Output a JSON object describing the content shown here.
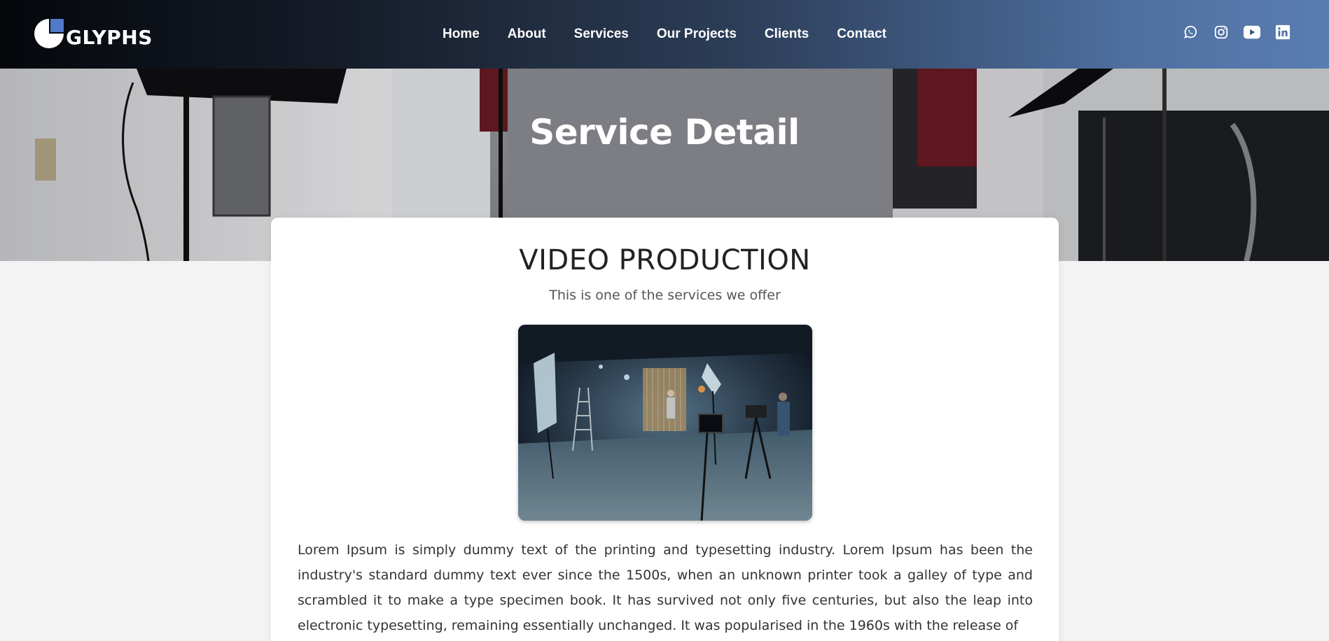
{
  "brand": {
    "logo_text": "GLYPHS",
    "accent": "#4f79c9"
  },
  "nav": {
    "items": [
      {
        "label": "Home"
      },
      {
        "label": "About"
      },
      {
        "label": "Services"
      },
      {
        "label": "Our Projects"
      },
      {
        "label": "Clients"
      },
      {
        "label": "Contact"
      }
    ]
  },
  "socials": [
    "whatsapp-icon",
    "instagram-icon",
    "youtube-icon",
    "linkedin-icon"
  ],
  "hero": {
    "title": "Service Detail"
  },
  "service": {
    "title": "VIDEO PRODUCTION",
    "subtitle": "This is one of the services we offer",
    "body": "Lorem Ipsum is simply dummy text of the printing and typesetting industry. Lorem Ipsum has been the industry's standard dummy text ever since the 1500s, when an unknown printer took a galley of type and scrambled it to make a type specimen book. It has survived not only five centuries, but also the leap into electronic typesetting, remaining essentially unchanged. It was popularised in the 1960s with the release of"
  }
}
